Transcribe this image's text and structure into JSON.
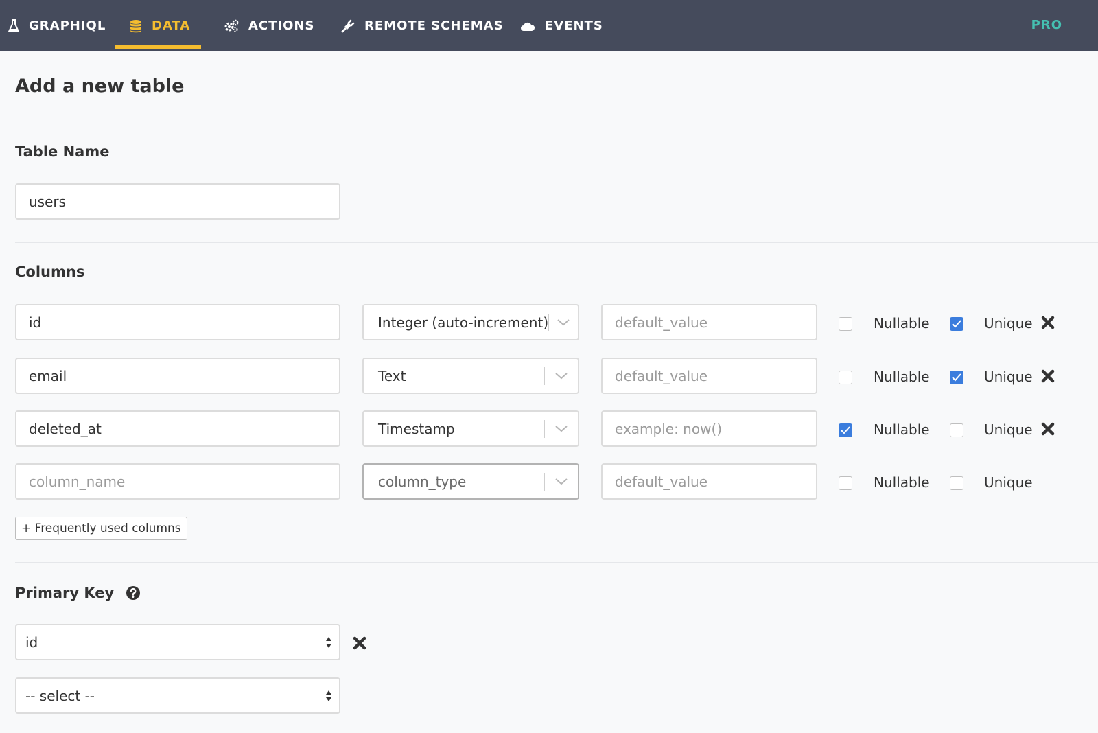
{
  "nav": {
    "tabs": [
      {
        "label": "GRAPHIQL",
        "icon": "flask-icon",
        "active": false
      },
      {
        "label": "DATA",
        "icon": "database-icon",
        "active": true
      },
      {
        "label": "ACTIONS",
        "icon": "cogs-icon",
        "active": false
      },
      {
        "label": "REMOTE SCHEMAS",
        "icon": "plug-icon",
        "active": false
      },
      {
        "label": "EVENTS",
        "icon": "cloud-icon",
        "active": false
      }
    ],
    "pro_label": "PRO",
    "colors": {
      "bar": "#454b5c",
      "active": "#f5bd2f",
      "pro": "#45c0b1"
    }
  },
  "page": {
    "title": "Add a new table"
  },
  "table_name": {
    "label": "Table Name",
    "value": "users"
  },
  "columns": {
    "label": "Columns",
    "nullable_label": "Nullable",
    "unique_label": "Unique",
    "rows": [
      {
        "name": "id",
        "name_placeholder": "column_name",
        "type": "Integer (auto-increment)",
        "default_placeholder": "default_value",
        "nullable": false,
        "unique": true,
        "removable": true
      },
      {
        "name": "email",
        "name_placeholder": "column_name",
        "type": "Text",
        "default_placeholder": "default_value",
        "nullable": false,
        "unique": true,
        "removable": true
      },
      {
        "name": "deleted_at",
        "name_placeholder": "column_name",
        "type": "Timestamp",
        "default_placeholder": "example: now()",
        "nullable": true,
        "unique": false,
        "removable": true
      },
      {
        "name": "",
        "name_placeholder": "column_name",
        "type": "column_type",
        "default_placeholder": "default_value",
        "nullable": false,
        "unique": false,
        "removable": false
      }
    ],
    "frequently_used_label": "+ Frequently used columns"
  },
  "primary_key": {
    "label": "Primary Key",
    "help_icon": "question-circle-icon",
    "selected": "id",
    "new_placeholder": "-- select --"
  },
  "accent_colors": {
    "checkbox": "#3b7ddd"
  }
}
